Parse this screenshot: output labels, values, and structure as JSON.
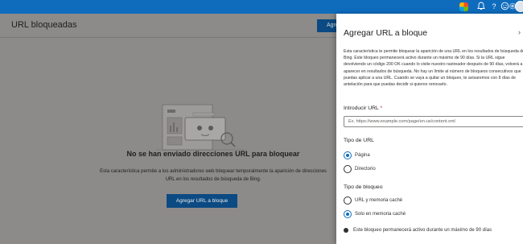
{
  "topbar": {
    "icons": [
      "copilot-icon",
      "notification-icon",
      "help-icon",
      "feedback-icon",
      "settings-icon",
      "avatar"
    ],
    "help_glyph": "?"
  },
  "page": {
    "title": "URL bloqueadas",
    "add_button_label": "Agregar URL a bloque",
    "empty_title": "No se han enviado direcciones URL para bloquear",
    "empty_description": "Esta característica permite a los administradores web bloquear temporalmente la aparición de direcciones URL en los resultados de búsqueda de Bing.",
    "empty_button_label": "Agregar URL a bloque"
  },
  "panel": {
    "title": "Agregar URL a bloque",
    "close_glyph": "›",
    "description": "Esta característica te permite bloquear la aparición de una URL en los resultados de búsqueda de Bing. Este bloqueo permanecerá activo durante un máximo de 90 días. Si la URL sigue devolviendo un código 200 OK cuando lo visite nuestro rastreador después de 90 días, volverá a aparecer en resultados de búsqueda. No hay un límite al número de bloqueos consecutivos que puedas aplicar a una URL. Cuando se vaya a quitar un bloqueo, te avisaremos con 8 días de antelación para que puedas decidir si quieres renovarlo.",
    "url_label": "Introducir URL",
    "url_required_mark": "*",
    "url_placeholder": "Ex. https://www.example.com/page/en-us/content.xml",
    "url_value": "",
    "url_type_label": "Tipo de URL",
    "url_type_options": [
      "Página",
      "Directorio"
    ],
    "url_type_selected": "Página",
    "block_type_label": "Tipo de bloqueo",
    "block_type_options": [
      "URL y memoria caché",
      "Solo en memoria caché"
    ],
    "block_type_selected": "Solo en memoria caché",
    "info_text": "Este bloqueo permanecerá activo durante un máximo de 90 días"
  },
  "colors": {
    "accent": "#0f6cbd",
    "overlay": "#8a8886"
  }
}
